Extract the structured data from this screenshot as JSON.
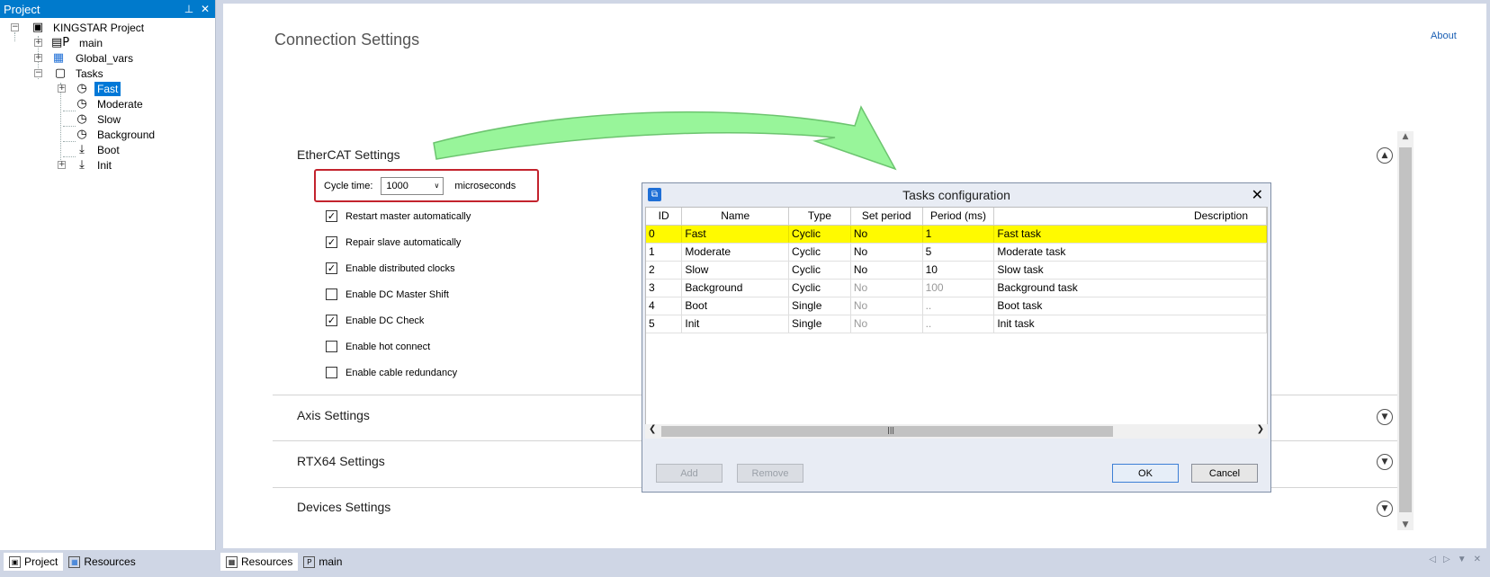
{
  "project_panel": {
    "title": "Project",
    "pin_glyph": "⊥",
    "close_glyph": "✕",
    "tree": {
      "root": "KINGSTAR Project",
      "main": "main",
      "global_vars": "Global_vars",
      "tasks": "Tasks",
      "task_items": [
        "Fast",
        "Moderate",
        "Slow",
        "Background",
        "Boot",
        "Init"
      ],
      "selected": "Fast"
    },
    "bottom_tabs": [
      "Project",
      "Resources"
    ]
  },
  "main_tabs": [
    "Resources",
    "main"
  ],
  "main": {
    "title": "Connection Settings",
    "about": "About",
    "ethercat": {
      "title": "EtherCAT Settings",
      "cycle_label": "Cycle time:",
      "cycle_value": "1000",
      "cycle_unit": "microseconds",
      "options": [
        {
          "label": "Restart master automatically",
          "checked": true
        },
        {
          "label": "Repair slave automatically",
          "checked": true
        },
        {
          "label": "Enable distributed clocks",
          "checked": true
        },
        {
          "label": "Enable DC Master Shift",
          "checked": false
        },
        {
          "label": "Enable DC Check",
          "checked": true
        },
        {
          "label": "Enable hot connect",
          "checked": false
        },
        {
          "label": "Enable cable redundancy",
          "checked": false
        }
      ]
    },
    "sections": [
      "Axis Settings",
      "RTX64 Settings",
      "Devices Settings"
    ]
  },
  "dialog": {
    "title": "Tasks configuration",
    "columns": [
      "ID",
      "Name",
      "Type",
      "Set period",
      "Period (ms)",
      "Description"
    ],
    "rows": [
      {
        "id": "0",
        "name": "Fast",
        "type": "Cyclic",
        "set_period": "No",
        "period": "1",
        "description": "Fast task"
      },
      {
        "id": "1",
        "name": "Moderate",
        "type": "Cyclic",
        "set_period": "No",
        "period": "5",
        "description": "Moderate task"
      },
      {
        "id": "2",
        "name": "Slow",
        "type": "Cyclic",
        "set_period": "No",
        "period": "10",
        "description": "Slow task"
      },
      {
        "id": "3",
        "name": "Background",
        "type": "Cyclic",
        "set_period": "No",
        "period": "100",
        "description": "Background task"
      },
      {
        "id": "4",
        "name": "Boot",
        "type": "Single",
        "set_period": "No",
        "period": "..",
        "description": "Boot task"
      },
      {
        "id": "5",
        "name": "Init",
        "type": "Single",
        "set_period": "No",
        "period": "..",
        "description": "Init task"
      }
    ],
    "buttons": {
      "add": "Add",
      "remove": "Remove",
      "ok": "OK",
      "cancel": "Cancel"
    }
  },
  "colors": {
    "accent": "#007acc",
    "highlight_row": "#fffa00",
    "red_box": "#c3232d",
    "arrow": "#98f59a"
  }
}
